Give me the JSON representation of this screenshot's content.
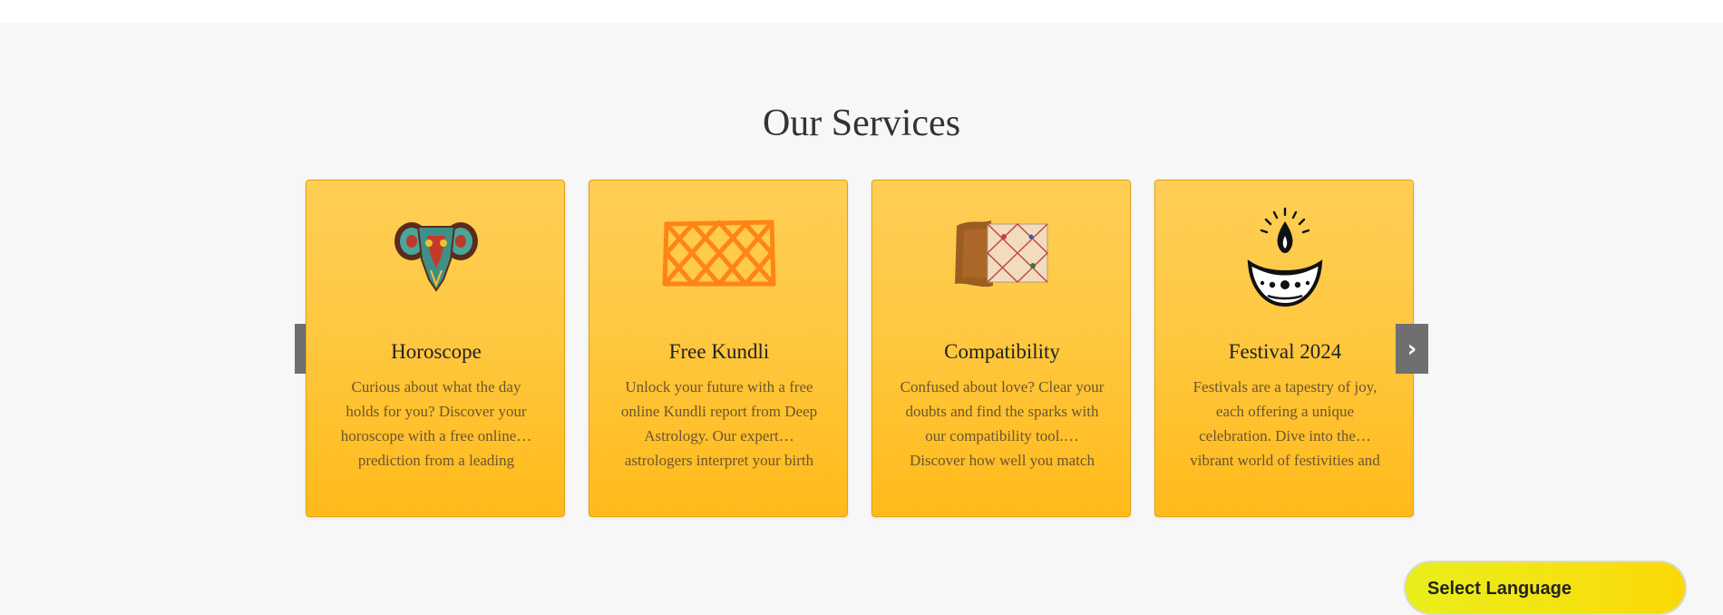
{
  "section": {
    "title": "Our Services"
  },
  "services": [
    {
      "icon": "aries-ram-icon",
      "title": "Horoscope",
      "description": "Curious about what the day holds for you? Discover your horoscope with a free online… prediction from a leading"
    },
    {
      "icon": "kundli-chart-icon",
      "title": "Free Kundli",
      "description": "Unlock your future with a free online Kundli report from Deep Astrology. Our expert… astrologers interpret your birth"
    },
    {
      "icon": "compatibility-chart-icon",
      "title": "Compatibility",
      "description": "Confused about love? Clear your doubts and find the sparks with our compatibility tool.… Discover how well you match"
    },
    {
      "icon": "diya-lamp-icon",
      "title": "Festival 2024",
      "description": "Festivals are a tapestry of joy, each offering a unique celebration. Dive into the… vibrant world of festivities and"
    }
  ],
  "carousel": {
    "prev_label": "‹",
    "next_label": "›"
  },
  "language": {
    "label": "Select Language"
  },
  "colors": {
    "card_top": "#ffcc50",
    "card_bottom": "#ffb812",
    "accent_orange": "#ff8a1a",
    "lang_yellow": "#f4e312"
  }
}
